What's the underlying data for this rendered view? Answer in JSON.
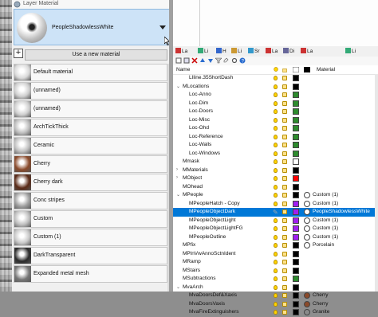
{
  "left_panel": {
    "title": "Layer Material",
    "selected_material": "PeopleShadowlessWhite",
    "use_new_button": "Use a new material",
    "use_new_icon": "plus-icon",
    "materials": [
      {
        "label": "Default material",
        "thumb": "#d9d9d9"
      },
      {
        "label": "(unnamed)",
        "thumb": "#cfcfcf"
      },
      {
        "label": "(unnamed)",
        "thumb": "#cfcfcf"
      },
      {
        "label": "ArchTickThick",
        "thumb": "#bdbdbd"
      },
      {
        "label": "Ceramic",
        "thumb": "#c0c0c0"
      },
      {
        "label": "Cherry",
        "thumb": "#8a4a2b"
      },
      {
        "label": "Cherry dark",
        "thumb": "#5a2a17"
      },
      {
        "label": "Conc stripes",
        "thumb": "#9f9f9f"
      },
      {
        "label": "Custom",
        "thumb": "#bfbfbf"
      },
      {
        "label": "Custom (1)",
        "thumb": "#c9c9c9"
      },
      {
        "label": "DarkTransparent",
        "thumb": "#2b2b2b"
      },
      {
        "label": "Expanded metal mesh",
        "thumb": "#777777"
      }
    ]
  },
  "tabs": [
    {
      "label": "La",
      "icon": "layers-icon"
    },
    {
      "label": "Li",
      "icon": "lights-icon"
    },
    {
      "label": "H",
      "icon": "help-icon"
    },
    {
      "label": "Li",
      "icon": "library-icon"
    },
    {
      "label": "Sr",
      "icon": "snapshot-icon"
    },
    {
      "label": "La",
      "icon": "layers-icon"
    },
    {
      "label": "Di",
      "icon": "display-icon"
    },
    {
      "label": "La",
      "icon": "layers-icon"
    },
    {
      "label": "Li",
      "icon": "library-icon"
    }
  ],
  "columns": {
    "name": "Name",
    "material": "Material"
  },
  "layers": [
    {
      "name": "LIline.35ShortDash",
      "indent": 1,
      "expander": "",
      "bulb": true,
      "color": "#000000",
      "mat_color": "",
      "mat": ""
    },
    {
      "name": "MLocations",
      "indent": 0,
      "expander": "⌄",
      "bulb": true,
      "color": "#000000",
      "mat_color": "",
      "mat": ""
    },
    {
      "name": "Loc-Anno",
      "indent": 1,
      "expander": "",
      "bulb": true,
      "color": "#2e8b2e",
      "mat_color": "",
      "mat": ""
    },
    {
      "name": "Loc-Dim",
      "indent": 1,
      "expander": "",
      "bulb": true,
      "color": "#2e8b2e",
      "mat_color": "",
      "mat": ""
    },
    {
      "name": "Loc-Doors",
      "indent": 1,
      "expander": "",
      "bulb": true,
      "color": "#2e8b2e",
      "mat_color": "",
      "mat": ""
    },
    {
      "name": "Loc-Misc",
      "indent": 1,
      "expander": "",
      "bulb": true,
      "color": "#2e8b2e",
      "mat_color": "",
      "mat": ""
    },
    {
      "name": "Loc-Ohd",
      "indent": 1,
      "expander": "",
      "bulb": true,
      "color": "#2e8b2e",
      "mat_color": "",
      "mat": ""
    },
    {
      "name": "Loc-Reference",
      "indent": 1,
      "expander": "",
      "bulb": true,
      "color": "#2e8b2e",
      "mat_color": "",
      "mat": ""
    },
    {
      "name": "Loc-Walls",
      "indent": 1,
      "expander": "",
      "bulb": true,
      "color": "#2e8b2e",
      "mat_color": "",
      "mat": ""
    },
    {
      "name": "Loc-Windows",
      "indent": 1,
      "expander": "",
      "bulb": true,
      "color": "#2e8b2e",
      "mat_color": "",
      "mat": ""
    },
    {
      "name": "Mmask",
      "indent": 0,
      "expander": "",
      "bulb": true,
      "color": "#ffffff",
      "mat_color": "",
      "mat": ""
    },
    {
      "name": "MMaterials",
      "indent": 0,
      "expander": "›",
      "bulb": true,
      "color": "#000000",
      "mat_color": "",
      "mat": ""
    },
    {
      "name": "MObject",
      "indent": 0,
      "expander": "›",
      "bulb": true,
      "color": "#ff0000",
      "mat_color": "",
      "mat": ""
    },
    {
      "name": "MOhead",
      "indent": 0,
      "expander": "",
      "bulb": true,
      "color": "#000000",
      "mat_color": "",
      "mat": ""
    },
    {
      "name": "MPeople",
      "indent": 0,
      "expander": "⌄",
      "bulb": true,
      "color": "#000000",
      "mat_color": "#ffffff",
      "mat": "Custom (1)"
    },
    {
      "name": "MPeopleHatch - Copy",
      "indent": 1,
      "expander": "",
      "bulb": true,
      "color": "#a020f0",
      "mat_color": "#ffffff",
      "mat": "Custom (1)"
    },
    {
      "name": "MPeopleObjectDark",
      "indent": 1,
      "expander": "",
      "bulb": false,
      "color": "#a020f0",
      "mat_color": "#ffffff",
      "mat": "PeopleShadowlessWhite",
      "selected": true
    },
    {
      "name": "MPeopleObjectLight",
      "indent": 1,
      "expander": "",
      "bulb": true,
      "color": "#a020f0",
      "mat_color": "#ffffff",
      "mat": "Custom (1)"
    },
    {
      "name": "MPeopleObjectLightFG",
      "indent": 1,
      "expander": "",
      "bulb": true,
      "color": "#a020f0",
      "mat_color": "#ffffff",
      "mat": "Custom (1)"
    },
    {
      "name": "MPeopleOutline",
      "indent": 1,
      "expander": "",
      "bulb": true,
      "color": "#a020f0",
      "mat_color": "#ffffff",
      "mat": "Custom (1)"
    },
    {
      "name": "MPfix",
      "indent": 0,
      "expander": "",
      "bulb": true,
      "color": "#000000",
      "mat_color": "#ffffff",
      "mat": "Porcelain"
    },
    {
      "name": "MPlnVwAnnoSctnIdent",
      "indent": 0,
      "expander": "",
      "bulb": true,
      "color": "#000000",
      "mat_color": "",
      "mat": ""
    },
    {
      "name": "MRamp",
      "indent": 0,
      "expander": "",
      "bulb": true,
      "color": "#000000",
      "mat_color": "",
      "mat": ""
    },
    {
      "name": "MStairs",
      "indent": 0,
      "expander": "",
      "bulb": true,
      "color": "#000000",
      "mat_color": "",
      "mat": ""
    },
    {
      "name": "MSubtractions",
      "indent": 0,
      "expander": "",
      "bulb": true,
      "color": "#2e8b2e",
      "mat_color": "",
      "mat": ""
    },
    {
      "name": "MvaArch",
      "indent": 0,
      "expander": "⌄",
      "bulb": true,
      "color": "#000000",
      "mat_color": "",
      "mat": ""
    },
    {
      "name": "MvaDoorsDef&Xaxis",
      "indent": 1,
      "expander": "",
      "bulb": true,
      "color": "#000000",
      "mat_color": "#8a4a2b",
      "mat": "Cherry"
    },
    {
      "name": "MvaDoorsVaxis",
      "indent": 1,
      "expander": "",
      "bulb": true,
      "color": "#000000",
      "mat_color": "#8a4a2b",
      "mat": "Cherry"
    },
    {
      "name": "MvaFireExtinguishers",
      "indent": 1,
      "expander": "",
      "bulb": true,
      "color": "#000000",
      "mat_color": "#8a8a8a",
      "mat": "Granite"
    }
  ]
}
